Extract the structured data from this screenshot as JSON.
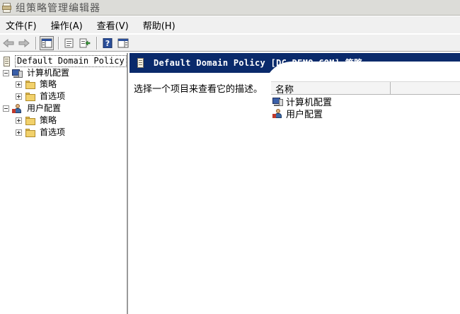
{
  "window": {
    "title": "组策略管理编辑器"
  },
  "menu": {
    "items": [
      "文件(F)",
      "操作(A)",
      "查看(V)",
      "帮助(H)"
    ]
  },
  "toolbar": {
    "buttons": [
      "back-arrow-icon",
      "forward-arrow-icon",
      "show-hide-console-tree-icon",
      "properties-icon",
      "export-list-icon",
      "help-icon",
      "show-action-pane-icon"
    ]
  },
  "tree": {
    "root": "Default Domain Policy",
    "computer_config": "计算机配置",
    "user_config": "用户配置",
    "policies": "策略",
    "preferences": "首选项"
  },
  "right_pane": {
    "header_title": "Default Domain Policy [DC.DEMO.COM] 策略",
    "description": "选择一个项目来查看它的描述。",
    "column_name": "名称",
    "rows": [
      "计算机配置",
      "用户配置"
    ]
  },
  "colors": {
    "header_band": "#0a2a6b",
    "title_bar": "#dcdcd8",
    "menu_bar": "#f0f0f0"
  }
}
